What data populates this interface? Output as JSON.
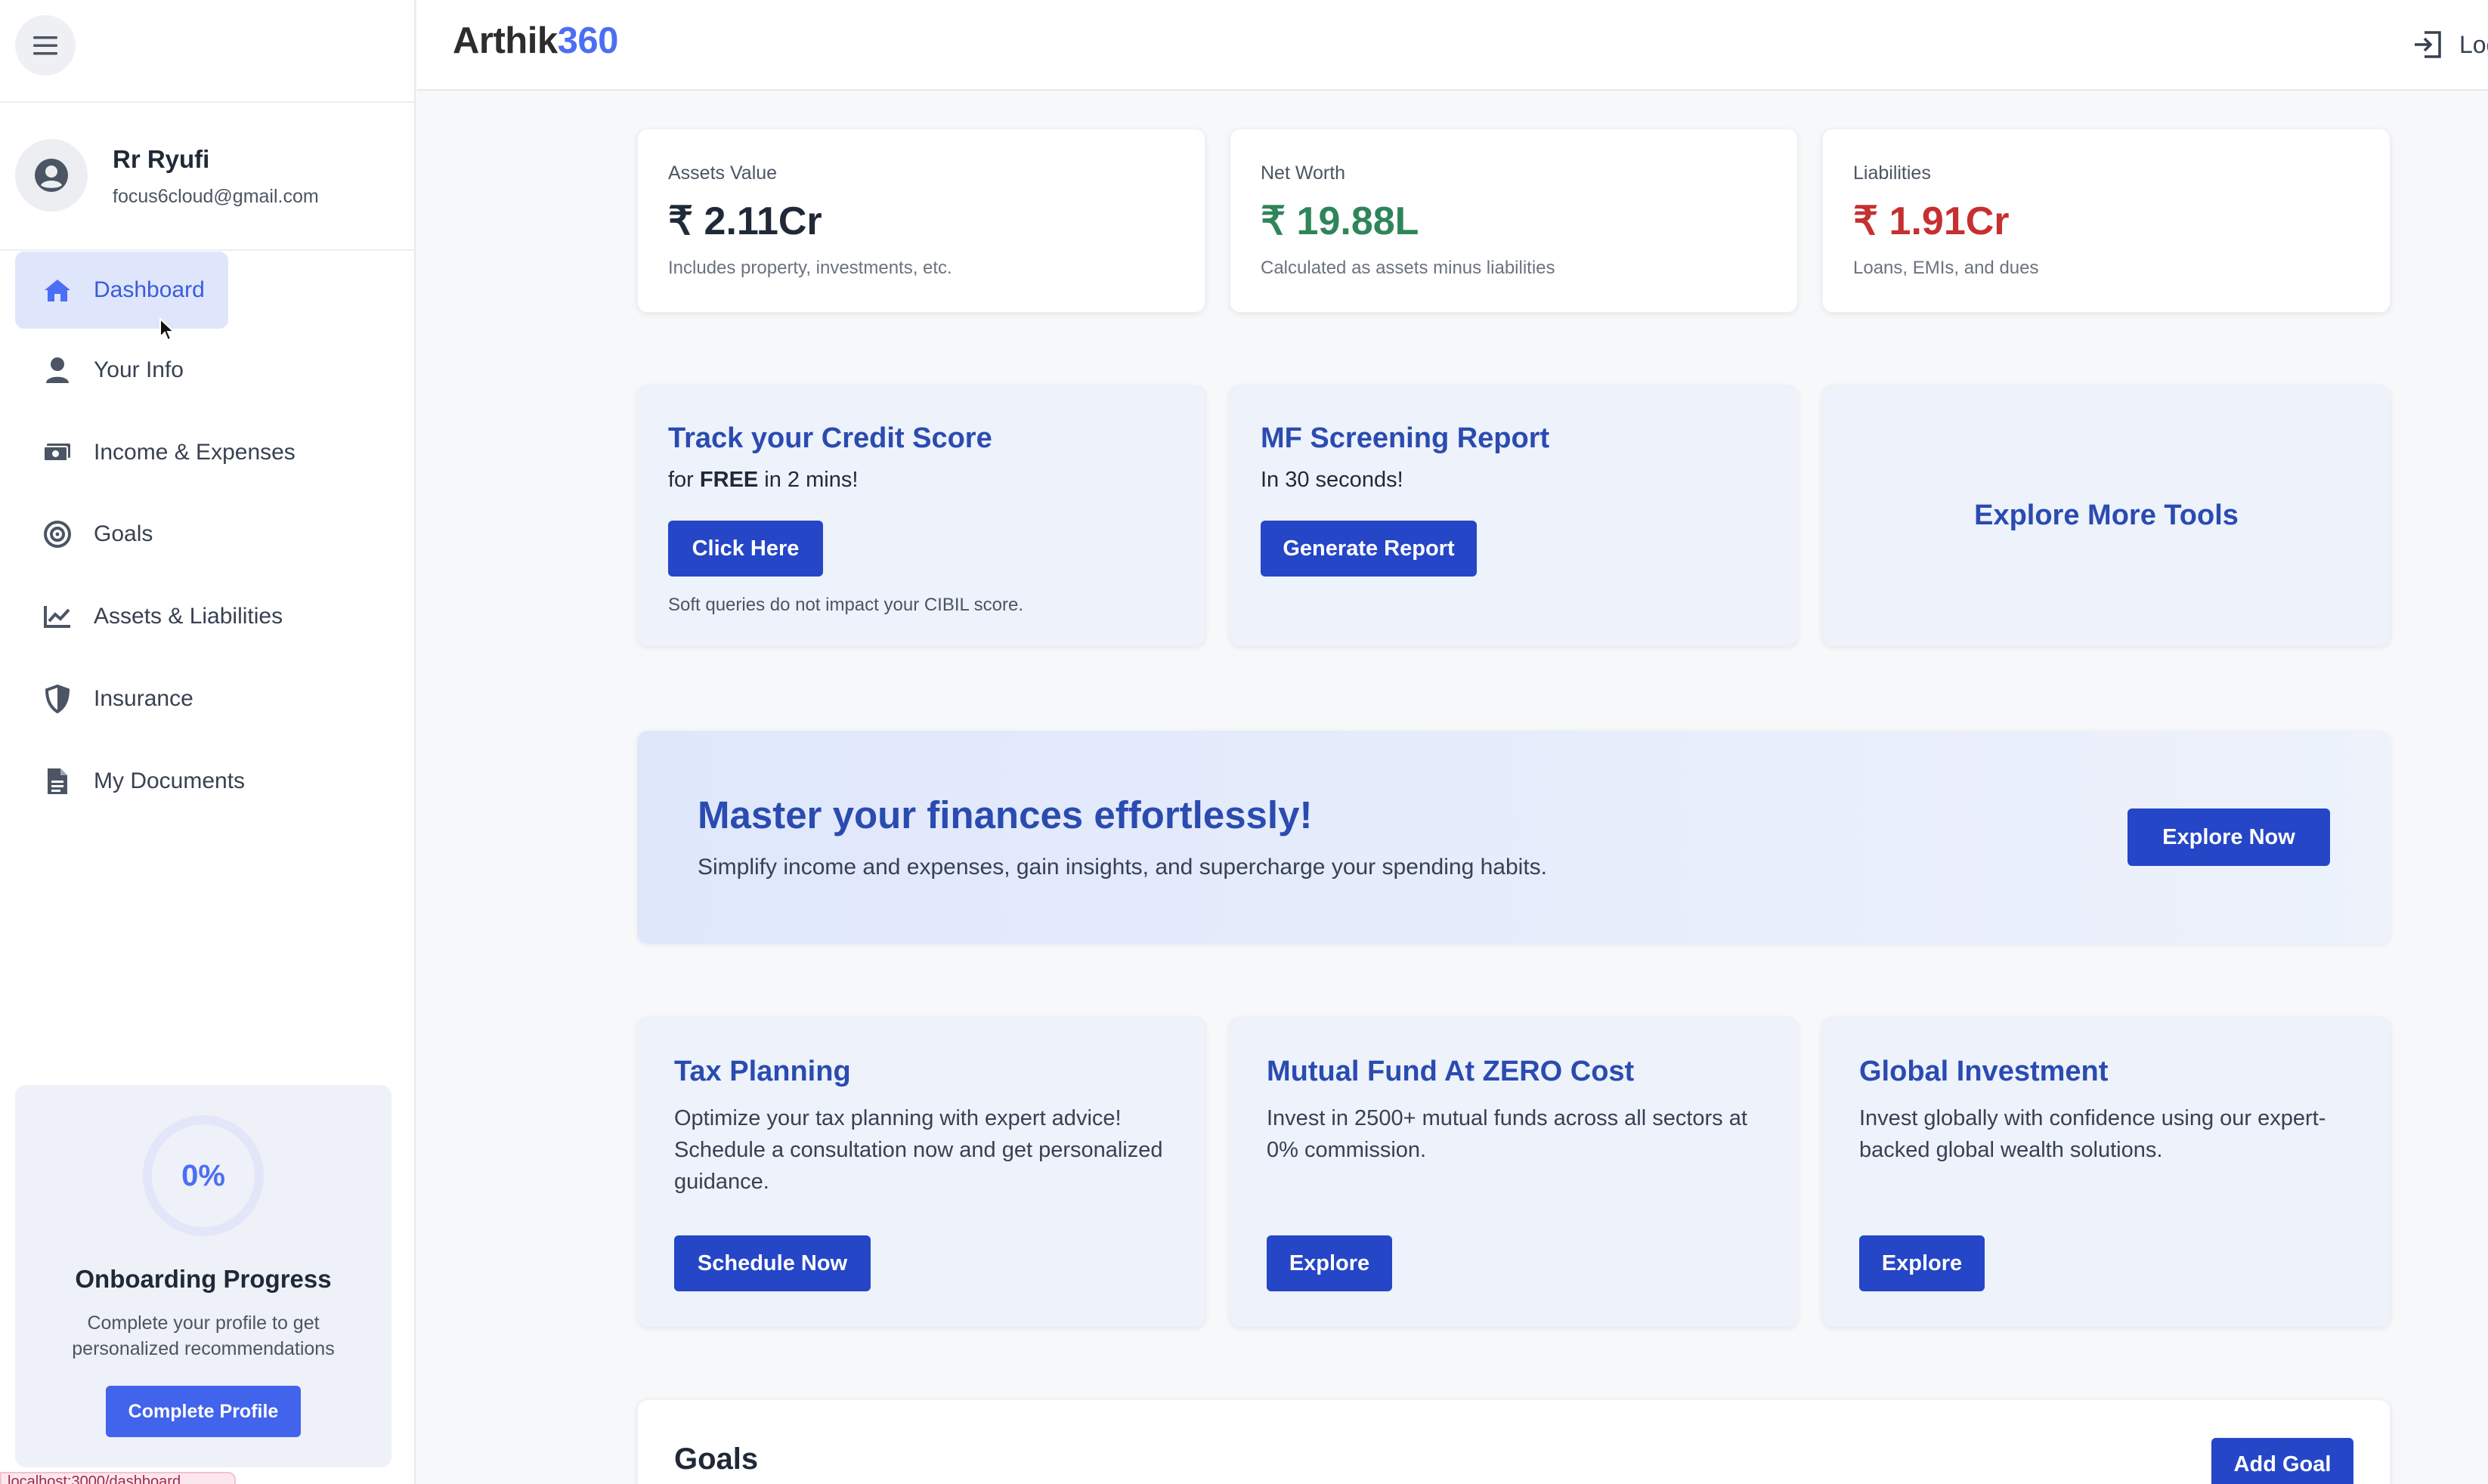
{
  "app": {
    "brand_main": "Arthik",
    "brand_accent": "360",
    "accent_color": "#4c6ef5"
  },
  "header": {
    "logout_label": "Logout"
  },
  "user": {
    "name": "Rr Ryufi",
    "email": "focus6cloud@gmail.com"
  },
  "sidebar": {
    "items": [
      {
        "label": "Dashboard",
        "icon": "home-icon",
        "active": true
      },
      {
        "label": "Your Info",
        "icon": "user-icon"
      },
      {
        "label": "Income & Expenses",
        "icon": "money-icon"
      },
      {
        "label": "Goals",
        "icon": "target-icon"
      },
      {
        "label": "Assets & Liabilities",
        "icon": "chart-line-icon"
      },
      {
        "label": "Insurance",
        "icon": "shield-icon"
      },
      {
        "label": "My Documents",
        "icon": "document-icon"
      }
    ]
  },
  "onboarding": {
    "percent_label": "0%",
    "progress": 0,
    "title": "Onboarding Progress",
    "description": "Complete your profile to get personalized recommendations",
    "button": "Complete Profile"
  },
  "status_toast": "localhost:3000/dashboard",
  "stats": [
    {
      "label": "Assets Value",
      "value": "₹ 2.11Cr",
      "note": "Includes property, investments, etc.",
      "color": "#1f2937"
    },
    {
      "label": "Net Worth",
      "value": "₹ 19.88L",
      "note": "Calculated as assets minus liabilities",
      "color": "#2f855a"
    },
    {
      "label": "Liabilities",
      "value": "₹ 1.91Cr",
      "note": "Loans, EMIs, and dues",
      "color": "#c53030"
    }
  ],
  "tools": {
    "credit": {
      "title": "Track your Credit Score",
      "sub_prefix": "for ",
      "sub_bold": "FREE",
      "sub_suffix": " in 2 mins!",
      "button": "Click Here",
      "note": "Soft queries do not impact your CIBIL score."
    },
    "mf": {
      "title": "MF Screening Report",
      "sub": "In 30 seconds!",
      "button": "Generate Report"
    },
    "more": {
      "title": "Explore More Tools"
    }
  },
  "banner": {
    "title": "Master your finances effortlessly!",
    "subtitle": "Simplify income and expenses, gain insights, and supercharge your spending habits.",
    "button": "Explore Now"
  },
  "services": [
    {
      "title": "Tax Planning",
      "description": "Optimize your tax planning with expert advice! Schedule a consultation now and get personalized guidance.",
      "button": "Schedule Now"
    },
    {
      "title": "Mutual Fund At ZERO Cost",
      "description": "Invest in 2500+ mutual funds across all sectors at 0% commission.",
      "button": "Explore"
    },
    {
      "title": "Global Investment",
      "description": "Invest globally with confidence using our expert-backed global wealth solutions.",
      "button": "Explore"
    }
  ],
  "goals": {
    "title": "Goals",
    "add_button": "Add Goal"
  }
}
